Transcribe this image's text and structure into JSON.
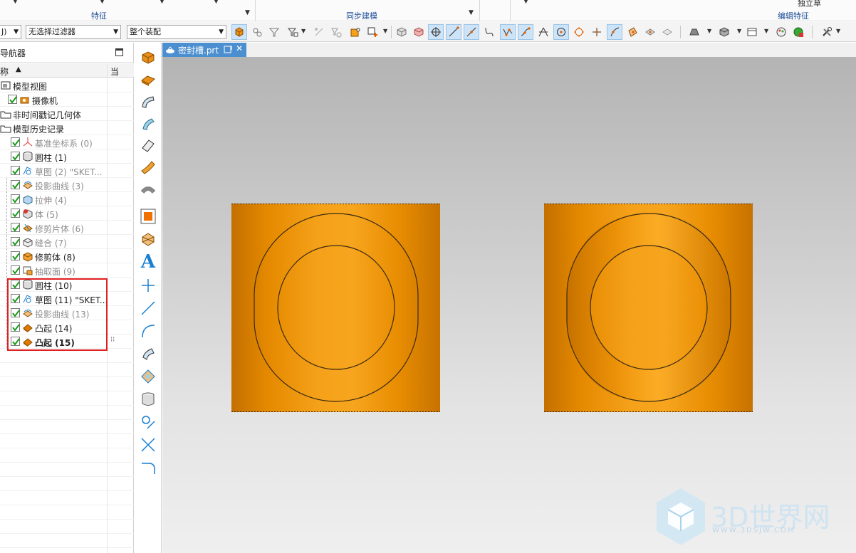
{
  "ribbon": {
    "groups": [
      {
        "label": "特征"
      },
      {
        "label": "同步建模"
      },
      {
        "label": "编辑特征"
      }
    ],
    "top_stub": "独立草"
  },
  "toolbar": {
    "left_stub": "J)",
    "filter_select": "无选择过滤器",
    "assembly_select": "整个装配"
  },
  "navigator": {
    "title": "导航器",
    "col_name": "称",
    "col_sort": "▲",
    "col_current": "当",
    "items": [
      {
        "label": "模型视图",
        "style": "normal",
        "icon": "model-views-icon"
      },
      {
        "label": "摄像机",
        "style": "normal",
        "icon": "camera-icon"
      },
      {
        "label": "非时间戳记几何体",
        "style": "normal",
        "icon": "folder-icon"
      },
      {
        "label": "模型历史记录",
        "style": "normal",
        "icon": "folder-icon"
      },
      {
        "label": "基准坐标系 (0)",
        "style": "grey",
        "icon": "datum-csys-icon"
      },
      {
        "label": "圆柱 (1)",
        "style": "normal",
        "icon": "cylinder-icon"
      },
      {
        "label": "草图 (2) \"SKET...",
        "style": "grey",
        "icon": "sketch-icon"
      },
      {
        "label": "投影曲线 (3)",
        "style": "grey",
        "icon": "projected-curve-icon"
      },
      {
        "label": "拉伸 (4)",
        "style": "grey",
        "icon": "extrude-icon"
      },
      {
        "label": "体 (5)",
        "style": "grey",
        "icon": "body-icon"
      },
      {
        "label": "修剪片体 (6)",
        "style": "grey",
        "icon": "trim-sheet-icon"
      },
      {
        "label": "缝合 (7)",
        "style": "grey",
        "icon": "sew-icon"
      },
      {
        "label": "修剪体 (8)",
        "style": "normal",
        "icon": "trim-body-icon"
      },
      {
        "label": "抽取面 (9)",
        "style": "grey",
        "icon": "extract-face-icon"
      },
      {
        "label": "圆柱 (10)",
        "style": "normal",
        "icon": "cylinder-icon"
      },
      {
        "label": "草图 (11) \"SKET...",
        "style": "normal",
        "icon": "sketch-icon"
      },
      {
        "label": "投影曲线 (13)",
        "style": "grey",
        "icon": "projected-curve-icon"
      },
      {
        "label": "凸起 (14)",
        "style": "normal",
        "icon": "emboss-icon"
      },
      {
        "label": "凸起 (15)",
        "style": "bold",
        "icon": "emboss-icon"
      }
    ]
  },
  "tab": {
    "label": "密封槽.prt",
    "close": "✕"
  },
  "watermark": {
    "brand": "3D世界网",
    "url": "WWW.3DSJW.COM"
  },
  "colors": {
    "accent": "#4c8fd0",
    "part_orange": "#f5a21a",
    "highlight_box": "#e02020",
    "check_green": "#1a9a1a"
  }
}
